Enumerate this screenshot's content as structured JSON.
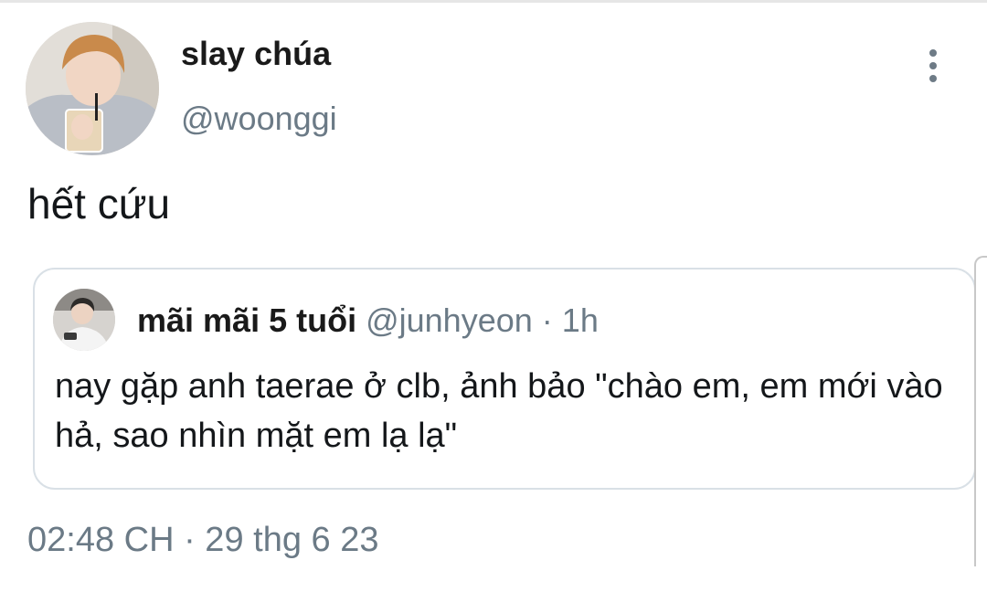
{
  "tweet": {
    "display_name": "slay chúa",
    "handle": "@woonggi",
    "text": "hết cứu",
    "timestamp": "02:48 CH · 29 thg 6 23",
    "avatar_icon": "profile-photo",
    "more_icon": "vertical-ellipsis-icon"
  },
  "quoted_tweet": {
    "display_name": "mãi mãi 5 tuổi",
    "handle": "@junhyeon",
    "separator": "·",
    "time": "1h",
    "text": "nay gặp anh taerae ở clb, ảnh bảo \"chào em, em mới vào hả, sao nhìn mặt em lạ lạ\"",
    "avatar_icon": "profile-photo"
  },
  "colors": {
    "primary_text": "#14171a",
    "secondary_text": "#6b7a86",
    "border": "#d9e0e6"
  }
}
